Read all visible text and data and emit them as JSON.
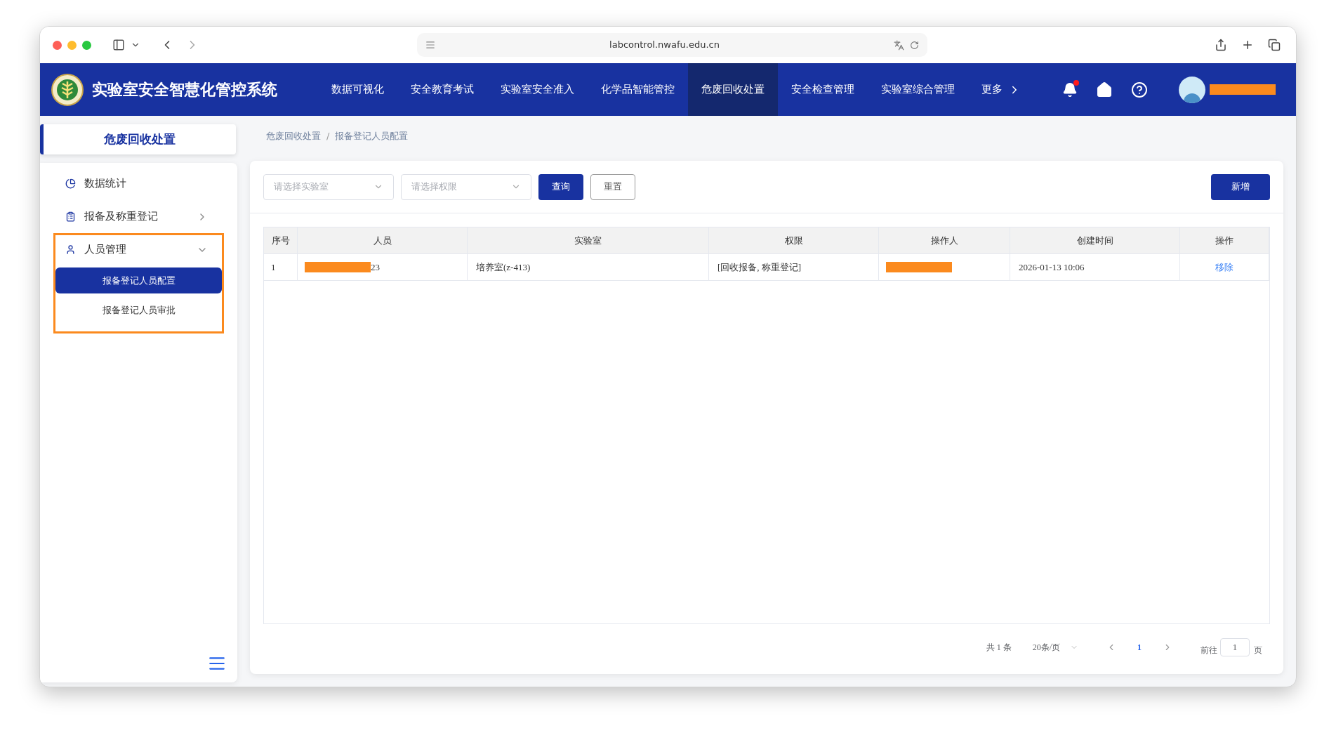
{
  "browser": {
    "url": "labcontrol.nwafu.edu.cn"
  },
  "header": {
    "title": "实验室安全智慧化管控系统",
    "notification_dot": true,
    "user_redacted": true,
    "nav": [
      {
        "label": "数据可视化",
        "selected": false
      },
      {
        "label": "安全教育考试",
        "selected": false
      },
      {
        "label": "实验室安全准入",
        "selected": false
      },
      {
        "label": "化学品智能管控",
        "selected": false
      },
      {
        "label": "危废回收处置",
        "selected": true
      },
      {
        "label": "安全检查管理",
        "selected": false
      },
      {
        "label": "实验室综合管理",
        "selected": false
      },
      {
        "label": "更多",
        "selected": false
      }
    ]
  },
  "sidebar": {
    "title": "危废回收处置",
    "items": [
      {
        "label": "数据统计",
        "kind": "link",
        "highlighted": false
      },
      {
        "label": "报备及称重登记",
        "kind": "group",
        "expanded": false,
        "highlighted": false
      },
      {
        "label": "人员管理",
        "kind": "group",
        "expanded": true,
        "highlighted": true,
        "children": [
          {
            "label": "报备登记人员配置",
            "selected": true
          },
          {
            "label": "报备登记人员审批",
            "selected": false
          }
        ]
      }
    ]
  },
  "breadcrumb": {
    "separator": "/",
    "items": [
      "危废回收处置",
      "报备登记人员配置"
    ]
  },
  "filters": [
    {
      "placeholder": "请选择实验室"
    },
    {
      "placeholder": "请选择权限"
    }
  ],
  "buttons": {
    "query": "查询",
    "reset": "重置",
    "add": "新增"
  },
  "table": {
    "columns": [
      "序号",
      "人员",
      "实验室",
      "权限",
      "操作人",
      "创建时间",
      "操作"
    ],
    "rows": [
      {
        "cells": [
          {
            "kind": "text",
            "text": "1"
          },
          {
            "kind": "redacted",
            "text": "23"
          },
          {
            "kind": "text",
            "text": "培养室(z-413)"
          },
          {
            "kind": "text",
            "text": "[回收报备, 称重登记]"
          },
          {
            "kind": "redacted"
          },
          {
            "kind": "text",
            "text": "2026-01-13 10:06"
          },
          {
            "kind": "link",
            "text": "移除"
          }
        ]
      }
    ]
  },
  "pagination": {
    "total": "共 1 条",
    "page_size": "20条/页",
    "pages": [
      {
        "label": "1",
        "selected": true
      }
    ],
    "goto_prefix": "前往",
    "goto_value": "1",
    "goto_suffix": "页"
  }
}
